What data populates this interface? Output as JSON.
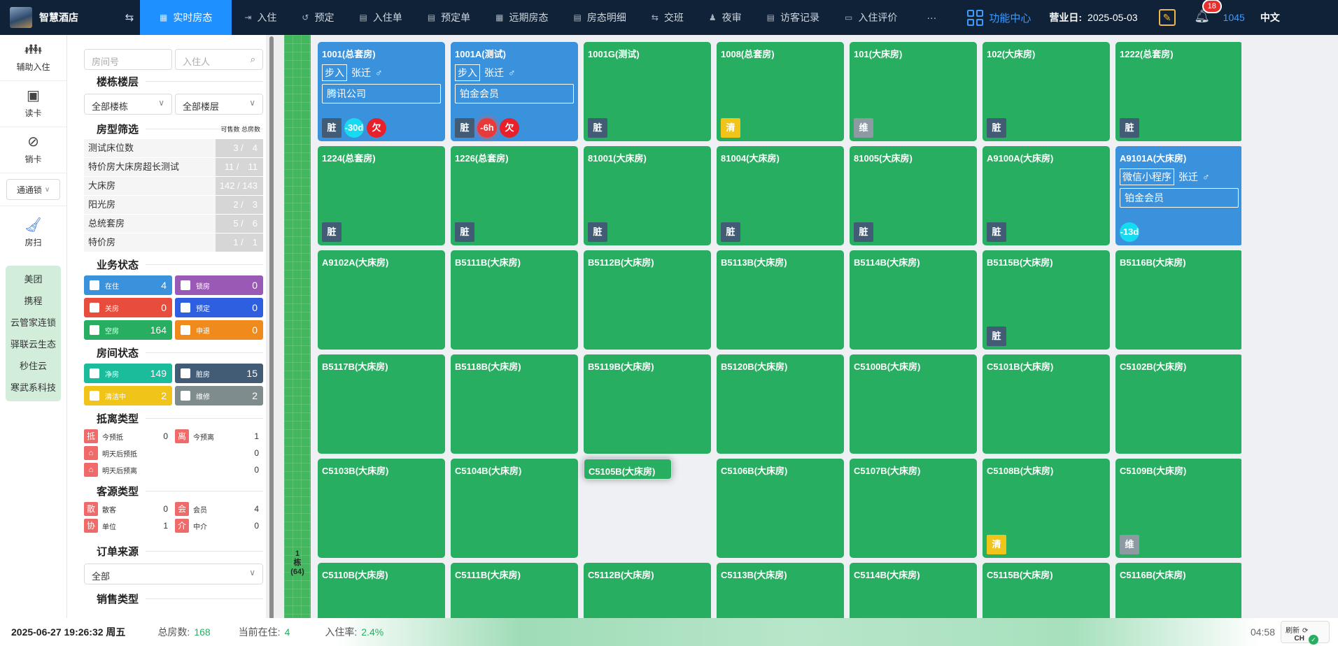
{
  "app": {
    "name": "智慧酒店"
  },
  "nav": {
    "tabs": [
      {
        "label": "实时房态",
        "icon": "▦",
        "active": true
      },
      {
        "label": "入住",
        "icon": "⇥"
      },
      {
        "label": "预定",
        "icon": "↺"
      },
      {
        "label": "入住单",
        "icon": "▤"
      },
      {
        "label": "预定单",
        "icon": "▤"
      },
      {
        "label": "远期房态",
        "icon": "▦"
      },
      {
        "label": "房态明细",
        "icon": "▤"
      },
      {
        "label": "交班",
        "icon": "⇆"
      },
      {
        "label": "夜审",
        "icon": "♟"
      },
      {
        "label": "访客记录",
        "icon": "▤"
      },
      {
        "label": "入住评价",
        "icon": "▭"
      }
    ],
    "more": "···",
    "func_center": "功能中心",
    "biz_date_label": "营业日:",
    "biz_date": "2025-05-03",
    "notif_count": "18",
    "user": "1045",
    "lang": "中文"
  },
  "leftbar": {
    "items": [
      {
        "label": "辅助入住",
        "icon": "users-icon"
      },
      {
        "label": "读卡",
        "icon": "card-reader-icon"
      },
      {
        "label": "销卡",
        "icon": "card-cancel-icon"
      }
    ],
    "lock_select": "通通锁",
    "housekeeping": "房扫",
    "channels": [
      "美团",
      "携程",
      "云管家连锁",
      "驿联云生态",
      "秒住云",
      "寒武系科技"
    ]
  },
  "filter": {
    "room_no_placeholder": "房间号",
    "guest_placeholder": "入住人",
    "building_title": "楼栋楼层",
    "all_buildings": "全部楼栋",
    "all_floors": "全部楼层",
    "roomtype_title": "房型筛选",
    "roomtype_hint": "可售数 总房数",
    "room_types": [
      {
        "name": "测试床位数",
        "count": "3 /　4"
      },
      {
        "name": "特价房大床房超长测试",
        "count": "11 /　11"
      },
      {
        "name": "大床房",
        "count": "142 / 143"
      },
      {
        "name": "阳光房",
        "count": "2 /　3"
      },
      {
        "name": "总统套房",
        "count": "5 /　6"
      },
      {
        "name": "特价房",
        "count": "1 /　1"
      }
    ],
    "biz_title": "业务状态",
    "biz_status": [
      {
        "label": "在住",
        "value": "4",
        "color": "#3a92dd"
      },
      {
        "label": "锁房",
        "value": "0",
        "color": "#9b59b6"
      },
      {
        "label": "关房",
        "value": "0",
        "color": "#e74c3c"
      },
      {
        "label": "预定",
        "value": "0",
        "color": "#2e5fe0"
      },
      {
        "label": "空房",
        "value": "164",
        "color": "#27ae60"
      },
      {
        "label": "申退",
        "value": "0",
        "color": "#f08a1c"
      }
    ],
    "room_title": "房间状态",
    "room_status": [
      {
        "label": "净房",
        "value": "149",
        "color": "#1abc9c"
      },
      {
        "label": "脏房",
        "value": "15",
        "color": "#425c76"
      },
      {
        "label": "清洁中",
        "value": "2",
        "color": "#f0c419"
      },
      {
        "label": "维修",
        "value": "2",
        "color": "#7f8c8d"
      }
    ],
    "arrdep_title": "抵离类型",
    "arrdep": {
      "today_arr": {
        "badge": "抵",
        "label": "今预抵",
        "value": "0"
      },
      "today_dep": {
        "badge": "离",
        "label": "今预离",
        "value": "1"
      },
      "tomorrow_arr": {
        "badge": "⌂",
        "label": "明天后预抵",
        "value": "0"
      },
      "tomorrow_dep": {
        "badge": "⌂",
        "label": "明天后预离",
        "value": "0"
      }
    },
    "source_title": "客源类型",
    "sources": [
      {
        "badge": "散",
        "label": "散客",
        "value": "0"
      },
      {
        "badge": "会",
        "label": "会员",
        "value": "4"
      },
      {
        "badge": "协",
        "label": "单位",
        "value": "1"
      },
      {
        "badge": "介",
        "label": "中介",
        "value": "0"
      }
    ],
    "order_title": "订单来源",
    "order_all": "全部",
    "sales_title": "销售类型"
  },
  "floor_label": "1\n栋\n(64)",
  "rooms": [
    {
      "name": "1001(总套房)",
      "occupied": true,
      "src": "步入",
      "guest": "张迁",
      "company": "腾讯公司",
      "tags": [
        {
          "t": "脏",
          "k": "dirty"
        }
      ],
      "circles": [
        {
          "t": "-30d",
          "k": "cyan"
        },
        {
          "t": "欠",
          "k": "red"
        }
      ]
    },
    {
      "name": "1001A(测试)",
      "occupied": true,
      "src": "步入",
      "guest": "张迁",
      "company": "铂金会员",
      "tags": [
        {
          "t": "脏",
          "k": "dirty"
        }
      ],
      "circles": [
        {
          "t": "-6h",
          "k": "glow"
        },
        {
          "t": "欠",
          "k": "red"
        }
      ]
    },
    {
      "name": "1001G(测试)",
      "tags": [
        {
          "t": "脏",
          "k": "dirty"
        }
      ]
    },
    {
      "name": "1008(总套房)",
      "tags": [
        {
          "t": "清",
          "k": "clean"
        }
      ]
    },
    {
      "name": "101(大床房)",
      "tags": [
        {
          "t": "维",
          "k": "maint"
        }
      ]
    },
    {
      "name": "102(大床房)",
      "tags": [
        {
          "t": "脏",
          "k": "dirty"
        }
      ]
    },
    {
      "name": "1222(总套房)",
      "tags": [
        {
          "t": "脏",
          "k": "dirty"
        }
      ]
    },
    {
      "name": "1224(总套房)",
      "tags": [
        {
          "t": "脏",
          "k": "dirty"
        }
      ]
    },
    {
      "name": "1226(总套房)",
      "tags": [
        {
          "t": "脏",
          "k": "dirty"
        }
      ]
    },
    {
      "name": "81001(大床房)",
      "tags": [
        {
          "t": "脏",
          "k": "dirty"
        }
      ]
    },
    {
      "name": "81004(大床房)",
      "tags": [
        {
          "t": "脏",
          "k": "dirty"
        }
      ]
    },
    {
      "name": "81005(大床房)",
      "tags": [
        {
          "t": "脏",
          "k": "dirty"
        }
      ]
    },
    {
      "name": "A9100A(大床房)",
      "tags": [
        {
          "t": "脏",
          "k": "dirty"
        }
      ]
    },
    {
      "name": "A9101A(大床房)",
      "occupied": true,
      "src": "微信小程序",
      "guest": "张迁",
      "company": "铂金会员",
      "circles": [
        {
          "t": "-13d",
          "k": "cyan"
        }
      ]
    },
    {
      "name": "A9102A(大床房)"
    },
    {
      "name": "B5111B(大床房)"
    },
    {
      "name": "B5112B(大床房)"
    },
    {
      "name": "B5113B(大床房)"
    },
    {
      "name": "B5114B(大床房)"
    },
    {
      "name": "B5115B(大床房)",
      "tags": [
        {
          "t": "脏",
          "k": "dirty"
        }
      ]
    },
    {
      "name": "B5116B(大床房)"
    },
    {
      "name": "B5117B(大床房)"
    },
    {
      "name": "B5118B(大床房)"
    },
    {
      "name": "B5119B(大床房)"
    },
    {
      "name": "B5120B(大床房)"
    },
    {
      "name": "C5100B(大床房)"
    },
    {
      "name": "C5101B(大床房)"
    },
    {
      "name": "C5102B(大床房)"
    },
    {
      "name": "C5103B(大床房)"
    },
    {
      "name": "C5104B(大床房)"
    },
    {
      "name": "C5105B(大床房)",
      "selected": true
    },
    {
      "name": "C5106B(大床房)"
    },
    {
      "name": "C5107B(大床房)"
    },
    {
      "name": "C5108B(大床房)",
      "tags": [
        {
          "t": "清",
          "k": "clean"
        }
      ]
    },
    {
      "name": "C5109B(大床房)",
      "tags": [
        {
          "t": "维",
          "k": "maint"
        }
      ]
    },
    {
      "name": "C5110B(大床房)"
    },
    {
      "name": "C5111B(大床房)"
    },
    {
      "name": "C5112B(大床房)"
    },
    {
      "name": "C5113B(大床房)"
    },
    {
      "name": "C5114B(大床房)"
    },
    {
      "name": "C5115B(大床房)"
    },
    {
      "name": "C5116B(大床房)"
    }
  ],
  "status": {
    "datetime": "2025-06-27 19:26:32 周五",
    "total_label": "总房数:",
    "total": "168",
    "occupied_label": "当前在住:",
    "occupied": "4",
    "rate_label": "入住率:",
    "rate": "2.4%",
    "clock": "04:58",
    "refresh": "刷新",
    "ime": "CH"
  }
}
